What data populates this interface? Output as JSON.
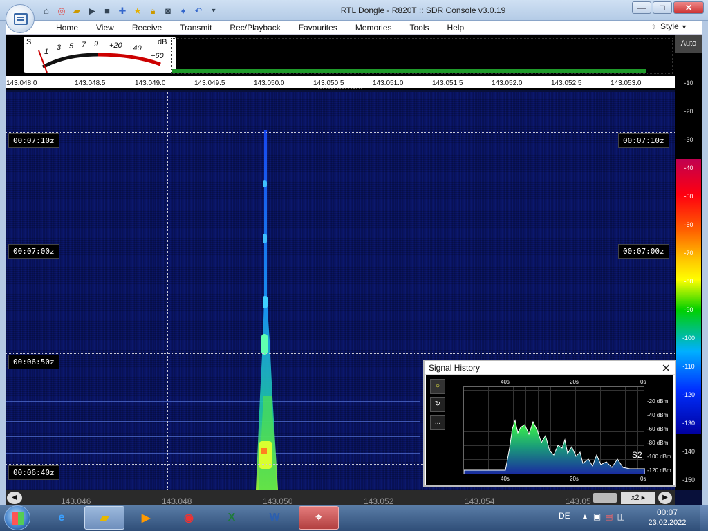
{
  "window": {
    "title": "RTL Dongle - R820T :: SDR Console v3.0.19",
    "controls": {
      "minimize": "—",
      "maximize": "□",
      "close": "✕"
    }
  },
  "quick_access": [
    "home-icon",
    "lifebuoy-icon",
    "folder-icon",
    "play-icon",
    "stop-icon",
    "plus-icon",
    "star-icon",
    "lock-icon",
    "camera-icon",
    "antenna-icon",
    "undo-icon",
    "dropdown-icon"
  ],
  "menu": {
    "items": [
      "Home",
      "View",
      "Receive",
      "Transmit",
      "Rec/Playback",
      "Favourites",
      "Memories",
      "Tools",
      "Help"
    ],
    "style_label": "Style"
  },
  "smeter": {
    "s_label": "S",
    "db_label": "dB",
    "s_ticks": [
      "1",
      "3",
      "5",
      "7",
      "9"
    ],
    "db_ticks": [
      "+20",
      "+40",
      "+60"
    ]
  },
  "freq_axis": {
    "ticks": [
      "143.048.0",
      "143.048.5",
      "143.049.0",
      "143.049.5",
      "143.050.0",
      "143.050.5",
      "143.051.0",
      "143.051.5",
      "143.052.0",
      "143.052.5",
      "143.053.0"
    ]
  },
  "waterfall": {
    "time_labels_left": [
      "00:07:10z",
      "00:07:00z",
      "00:06:50z",
      "00:06:40z"
    ],
    "time_labels_right": [
      "00:07:10z",
      "00:07:00z"
    ]
  },
  "scale": {
    "auto_label": "Auto",
    "ticks": [
      "-10",
      "-20",
      "-30",
      "-40",
      "-50",
      "-60",
      "-70",
      "-80",
      "-90",
      "-100",
      "-110",
      "-120",
      "-130",
      "-140",
      "-150"
    ]
  },
  "signal_history": {
    "title": "Signal History",
    "close": "✕",
    "top_axis": [
      "40s",
      "20s",
      "0s"
    ],
    "bottom_axis": [
      "40s",
      "20s",
      "0s"
    ],
    "y_axis": [
      "-20 dBm",
      "-40 dBm",
      "-60 dBm",
      "-80 dBm",
      "-100 dBm",
      "-120 dBm"
    ],
    "s_reading": "S2",
    "buttons": [
      "record-icon",
      "refresh-icon",
      "more-icon"
    ],
    "more_label": "...",
    "refresh_label": "↻"
  },
  "bottom_bar": {
    "ticks": [
      "143.046",
      "143.048",
      "143.050",
      "143.052",
      "143.054",
      "143.05"
    ],
    "zoom": "x2",
    "left_arrow": "◀",
    "right_arrow": "▶"
  },
  "taskbar": {
    "apps": [
      "ie",
      "explorer",
      "media",
      "chrome",
      "excel",
      "word",
      "sdr"
    ],
    "language": "DE",
    "time": "00:07",
    "date": "23.02.2022"
  }
}
